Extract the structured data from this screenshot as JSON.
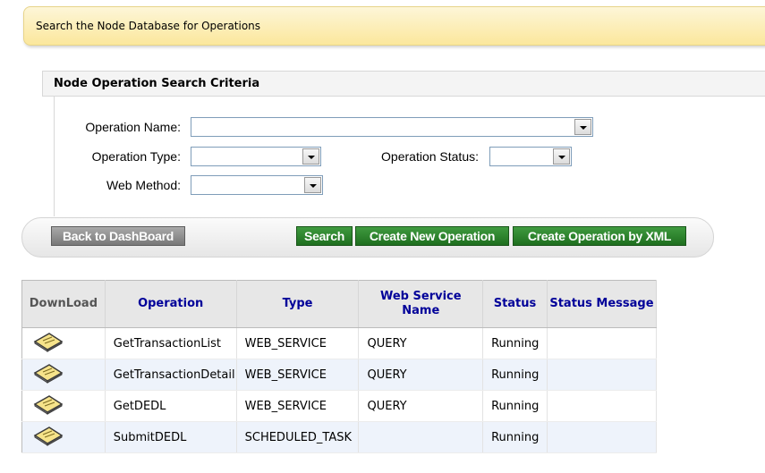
{
  "banner": {
    "text": "Search the Node Database for Operations"
  },
  "criteria": {
    "title": "Node Operation Search Criteria",
    "operation_name_label": "Operation Name:",
    "operation_name_value": "",
    "operation_type_label": "Operation Type:",
    "operation_type_value": "",
    "operation_status_label": "Operation Status:",
    "operation_status_value": "",
    "web_method_label": "Web Method:",
    "web_method_value": ""
  },
  "toolbar": {
    "back_label": "Back to DashBoard",
    "search_label": "Search",
    "create_label": "Create New Operation",
    "create_xml_label": "Create Operation by XML"
  },
  "table": {
    "headers": {
      "download": "DownLoad",
      "operation": "Operation",
      "type": "Type",
      "web_service_name": "Web Service Name",
      "status": "Status",
      "status_message": "Status Message"
    },
    "rows": [
      {
        "operation": "GetTransactionList",
        "type": "WEB_SERVICE",
        "web_service_name": "QUERY",
        "status": "Running",
        "status_message": ""
      },
      {
        "operation": "GetTransactionDetail",
        "type": "WEB_SERVICE",
        "web_service_name": "QUERY",
        "status": "Running",
        "status_message": ""
      },
      {
        "operation": "GetDEDL",
        "type": "WEB_SERVICE",
        "web_service_name": "QUERY",
        "status": "Running",
        "status_message": ""
      },
      {
        "operation": "SubmitDEDL",
        "type": "SCHEDULED_TASK",
        "web_service_name": "",
        "status": "Running",
        "status_message": ""
      }
    ],
    "download_icon": "download-document-icon"
  },
  "colors": {
    "banner_bg": "#fbe79c",
    "header_text": "#000099",
    "green_button": "#2f7f2f",
    "grey_button": "#8a8a8a",
    "alt_row": "#eef3fb"
  }
}
